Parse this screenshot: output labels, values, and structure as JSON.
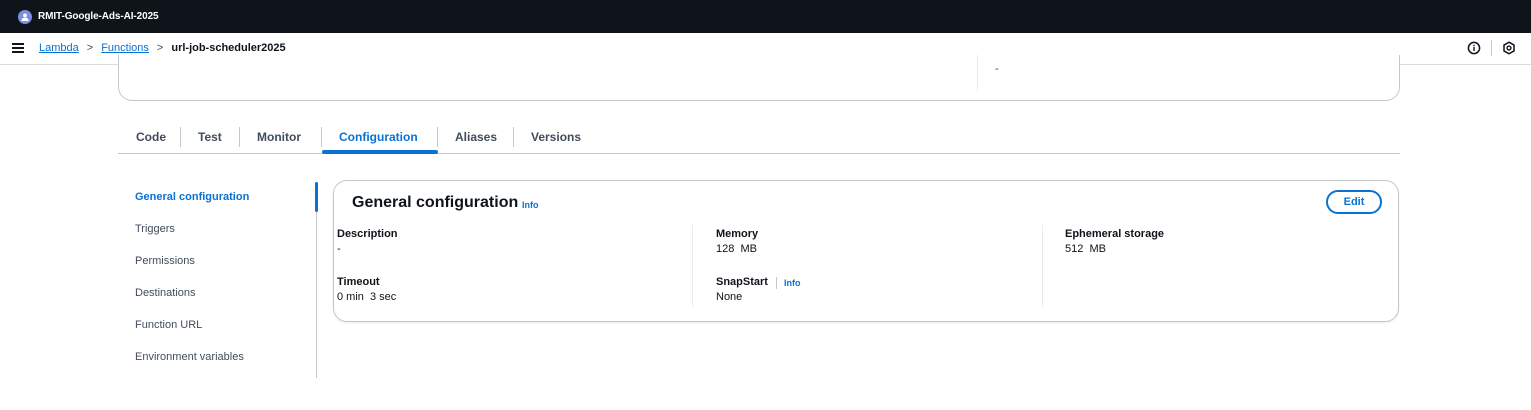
{
  "account": {
    "name": "RMIT-Google-Ads-AI-2025",
    "icon": "account-icon"
  },
  "nav": {
    "menu_icon": "hamburger-icon",
    "breadcrumbs": [
      {
        "label": "Lambda"
      },
      {
        "label": "Functions"
      },
      {
        "label": "url-job-scheduler2025"
      }
    ],
    "separator": ">",
    "right_icons": [
      "info-circle-icon",
      "settings-icon"
    ]
  },
  "overview": {
    "right_value": "-"
  },
  "tabs": [
    {
      "label": "Code"
    },
    {
      "label": "Test"
    },
    {
      "label": "Monitor"
    },
    {
      "label": "Configuration",
      "active": true
    },
    {
      "label": "Aliases"
    },
    {
      "label": "Versions"
    }
  ],
  "sidenav": [
    {
      "label": "General configuration",
      "active": true
    },
    {
      "label": "Triggers"
    },
    {
      "label": "Permissions"
    },
    {
      "label": "Destinations"
    },
    {
      "label": "Function URL"
    },
    {
      "label": "Environment variables"
    }
  ],
  "general_config": {
    "title": "General configuration",
    "info_label": "Info",
    "edit_label": "Edit",
    "description_label": "Description",
    "description_value": "-",
    "timeout_label": "Timeout",
    "timeout_value": "0 min  3 sec",
    "memory_label": "Memory",
    "memory_value": "128  MB",
    "snapstart_label": "SnapStart",
    "snapstart_info": "Info",
    "snapstart_value": "None",
    "ephemeral_label": "Ephemeral storage",
    "ephemeral_value": "512  MB"
  },
  "colors": {
    "accent": "#0972d3",
    "topbar": "#0f141a",
    "text": "#0f141a",
    "muted": "#414d5c",
    "border": "#c6c6cd"
  }
}
